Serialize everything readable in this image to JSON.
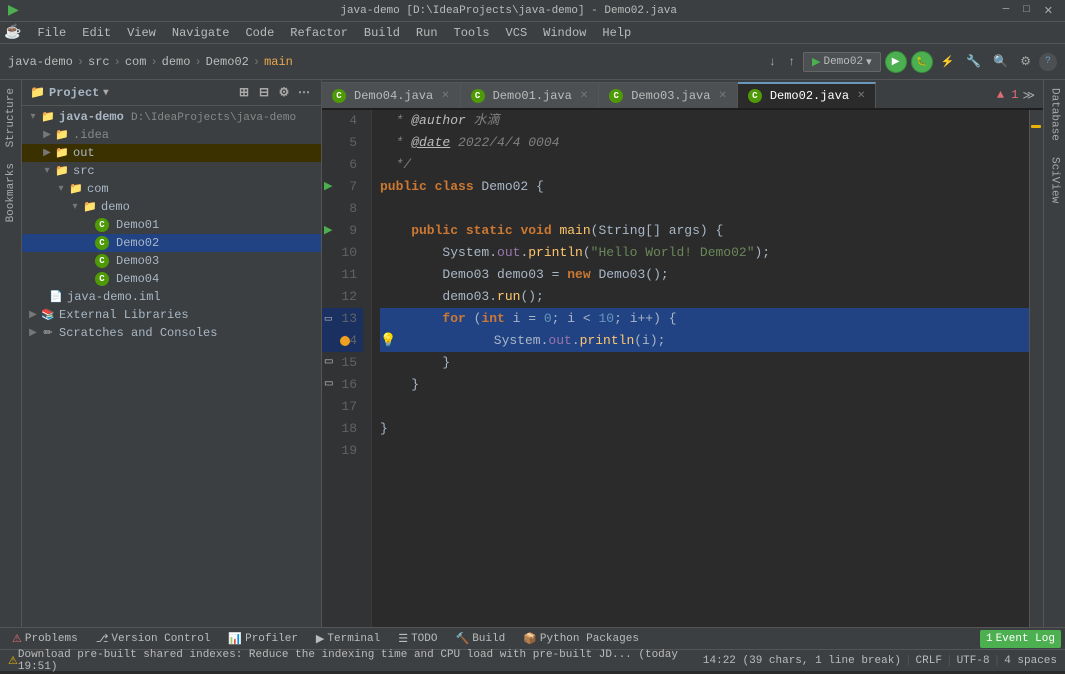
{
  "titlebar": {
    "title": "java-demo [D:\\IdeaProjects\\java-demo] - Demo02.java"
  },
  "menubar": {
    "items": [
      "File",
      "Edit",
      "View",
      "Navigate",
      "Code",
      "Refactor",
      "Build",
      "Run",
      "Tools",
      "VCS",
      "Window",
      "Help"
    ]
  },
  "toolbar": {
    "breadcrumbs": [
      "java-demo",
      "src",
      "com",
      "demo",
      "Demo02",
      "main"
    ],
    "run_config": "Demo02",
    "search_icon": "🔍",
    "settings_icon": "⚙"
  },
  "tabs": [
    {
      "label": "Demo04.java",
      "active": false
    },
    {
      "label": "Demo01.java",
      "active": false
    },
    {
      "label": "Demo03.java",
      "active": false
    },
    {
      "label": "Demo02.java",
      "active": true
    }
  ],
  "sidebar": {
    "title": "Project",
    "tree": [
      {
        "level": 0,
        "type": "project",
        "label": "java-demo",
        "extra": "D:\\IdeaProjects\\java-demo",
        "expanded": true
      },
      {
        "level": 1,
        "type": "folder",
        "label": ".idea",
        "expanded": false
      },
      {
        "level": 1,
        "type": "folder-out",
        "label": "out",
        "expanded": false,
        "selected": false
      },
      {
        "level": 1,
        "type": "folder",
        "label": "src",
        "expanded": true
      },
      {
        "level": 2,
        "type": "folder",
        "label": "com",
        "expanded": true
      },
      {
        "level": 3,
        "type": "folder",
        "label": "demo",
        "expanded": true
      },
      {
        "level": 4,
        "type": "java",
        "label": "Demo01"
      },
      {
        "level": 4,
        "type": "java",
        "label": "Demo02",
        "selected": true
      },
      {
        "level": 4,
        "type": "java",
        "label": "Demo03"
      },
      {
        "level": 4,
        "type": "java",
        "label": "Demo04"
      },
      {
        "level": 1,
        "type": "iml",
        "label": "java-demo.iml"
      },
      {
        "level": 0,
        "type": "lib",
        "label": "External Libraries",
        "expanded": false
      },
      {
        "level": 0,
        "type": "scratches",
        "label": "Scratches and Consoles",
        "expanded": false
      }
    ]
  },
  "editor": {
    "lines": [
      {
        "num": 4,
        "content": "  * @author 水滴",
        "tokens": [
          {
            "t": "comment",
            "v": "  * "
          },
          {
            "t": "anno",
            "v": "@author"
          },
          {
            "t": "comment",
            "v": " 水滴"
          }
        ]
      },
      {
        "num": 5,
        "content": "  * @date 2022/4/4 0004",
        "tokens": [
          {
            "t": "comment",
            "v": "  * "
          },
          {
            "t": "anno-name",
            "v": "@date"
          },
          {
            "t": "comment",
            "v": " 2022/4/4 0004"
          }
        ]
      },
      {
        "num": 6,
        "content": "  */",
        "tokens": [
          {
            "t": "comment",
            "v": "  */"
          }
        ]
      },
      {
        "num": 7,
        "content": "public class Demo02 {",
        "tokens": [
          {
            "t": "kw",
            "v": "public "
          },
          {
            "t": "kw",
            "v": "class "
          },
          {
            "t": "cls",
            "v": "Demo02"
          },
          {
            "t": "type",
            "v": " {"
          }
        ],
        "run_arrow": true
      },
      {
        "num": 8,
        "content": "",
        "tokens": []
      },
      {
        "num": 9,
        "content": "    public static void main(String[] args) {",
        "tokens": [
          {
            "t": "kw",
            "v": "    public "
          },
          {
            "t": "kw",
            "v": "static "
          },
          {
            "t": "kw",
            "v": "void "
          },
          {
            "t": "method",
            "v": "main"
          },
          {
            "t": "type",
            "v": "("
          },
          {
            "t": "cls",
            "v": "String"
          },
          {
            "t": "type",
            "v": "[] args) {"
          }
        ],
        "run_arrow": true
      },
      {
        "num": 10,
        "content": "        System.out.println(\"Hello World! Demo02\");",
        "tokens": [
          {
            "t": "type",
            "v": "        System."
          },
          {
            "t": "field",
            "v": "out"
          },
          {
            "t": "type",
            "v": "."
          },
          {
            "t": "method",
            "v": "println"
          },
          {
            "t": "type",
            "v": "("
          },
          {
            "t": "str",
            "v": "\"Hello World! Demo02\""
          },
          {
            "t": "type",
            "v": ");"
          }
        ]
      },
      {
        "num": 11,
        "content": "        Demo03 demo03 = new Demo03();",
        "tokens": [
          {
            "t": "cls",
            "v": "        Demo03"
          },
          {
            "t": "type",
            "v": " demo03 = "
          },
          {
            "t": "kw",
            "v": "new "
          },
          {
            "t": "cls",
            "v": "Demo03"
          },
          {
            "t": "type",
            "v": "();"
          }
        ]
      },
      {
        "num": 12,
        "content": "        demo03.run();",
        "tokens": [
          {
            "t": "type",
            "v": "        demo03."
          },
          {
            "t": "method",
            "v": "run"
          },
          {
            "t": "type",
            "v": "();"
          }
        ]
      },
      {
        "num": 13,
        "content": "        for (int i = 0; i < 10; i++) {",
        "tokens": [
          {
            "t": "kw",
            "v": "        for "
          },
          {
            "t": "type",
            "v": "("
          },
          {
            "t": "kw",
            "v": "int"
          },
          {
            "t": "type",
            "v": " i = "
          },
          {
            "t": "num",
            "v": "0"
          },
          {
            "t": "type",
            "v": "; i < "
          },
          {
            "t": "num",
            "v": "10"
          },
          {
            "t": "type",
            "v": "; i++) {"
          }
        ],
        "highlighted": true,
        "bookmark": true
      },
      {
        "num": 14,
        "content": "            System.out.println(i);",
        "tokens": [
          {
            "t": "type",
            "v": "            System."
          },
          {
            "t": "field",
            "v": "out"
          },
          {
            "t": "type",
            "v": "."
          },
          {
            "t": "method",
            "v": "println"
          },
          {
            "t": "type",
            "v": "(i);"
          }
        ],
        "highlighted": true,
        "debug_dot": true,
        "light_bulb": true
      },
      {
        "num": 15,
        "content": "        }",
        "tokens": [
          {
            "t": "type",
            "v": "        }"
          }
        ],
        "bookmark": true
      },
      {
        "num": 16,
        "content": "    }",
        "tokens": [
          {
            "t": "type",
            "v": "    }"
          }
        ],
        "bookmark": true
      },
      {
        "num": 17,
        "content": "",
        "tokens": []
      },
      {
        "num": 18,
        "content": "}",
        "tokens": [
          {
            "t": "type",
            "v": "}"
          }
        ]
      },
      {
        "num": 19,
        "content": "",
        "tokens": []
      }
    ]
  },
  "bottombar": {
    "items": [
      {
        "label": "Problems",
        "icon": "⚠",
        "active": false
      },
      {
        "label": "Version Control",
        "icon": "⎇",
        "active": false
      },
      {
        "label": "Profiler",
        "icon": "📊",
        "active": false
      },
      {
        "label": "Terminal",
        "icon": "▶",
        "active": false
      },
      {
        "label": "TODO",
        "icon": "☰",
        "active": false
      },
      {
        "label": "Build",
        "icon": "🔨",
        "active": false
      },
      {
        "label": "Python Packages",
        "icon": "📦",
        "active": false
      }
    ],
    "event_log": "Event Log",
    "event_count": "1"
  },
  "statusbar": {
    "warning": "⚠ Download pre-built shared indexes: Reduce the indexing time and CPU load with pre-built JD... (today 19:51)",
    "position": "14:22 (39 chars, 1 line break)",
    "crlf": "CRLF",
    "encoding": "UTF-8",
    "indent": "4 spaces"
  },
  "right_panels": [
    "Database",
    "SciView"
  ],
  "left_panels": [
    "Structure",
    "Bookmarks"
  ],
  "error_badge": "▲ 1"
}
